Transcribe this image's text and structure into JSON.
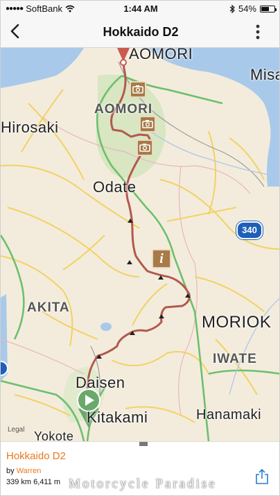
{
  "status": {
    "carrier": "SoftBank",
    "time": "1:44 AM",
    "battery": "54%"
  },
  "nav": {
    "title": "Hokkaido D2"
  },
  "map": {
    "labels": {
      "aomori_city": "AOMORI",
      "aomori_pref": "AOMORI",
      "misawa": "Misa",
      "hirosaki": "Hirosaki",
      "odate": "Odate",
      "akita": "AKITA",
      "morioka": "MORIOK",
      "iwate": "IWATE",
      "daisen": "Daisen",
      "kitakami": "Kitakami",
      "hanamaki": "Hanamaki",
      "yokote": "Yokote"
    },
    "road_shield": "340",
    "legal": "Legal",
    "info_pin": "i"
  },
  "route": {
    "title": "Hokkaido D2",
    "by_label": "by",
    "author": "Warren",
    "distance": "339 km",
    "elevation": "6,411 m"
  },
  "watermark": "Motorcycle Paradise",
  "colors": {
    "route": "#b2594f",
    "accent": "#e7791f",
    "pin": "#a87a47",
    "start": "#6ba86b"
  },
  "icons": [
    "back-chevron-icon",
    "more-vertical-icon",
    "wifi-icon",
    "bluetooth-icon",
    "battery-icon",
    "camera-icon",
    "info-icon",
    "play-icon",
    "share-icon"
  ]
}
